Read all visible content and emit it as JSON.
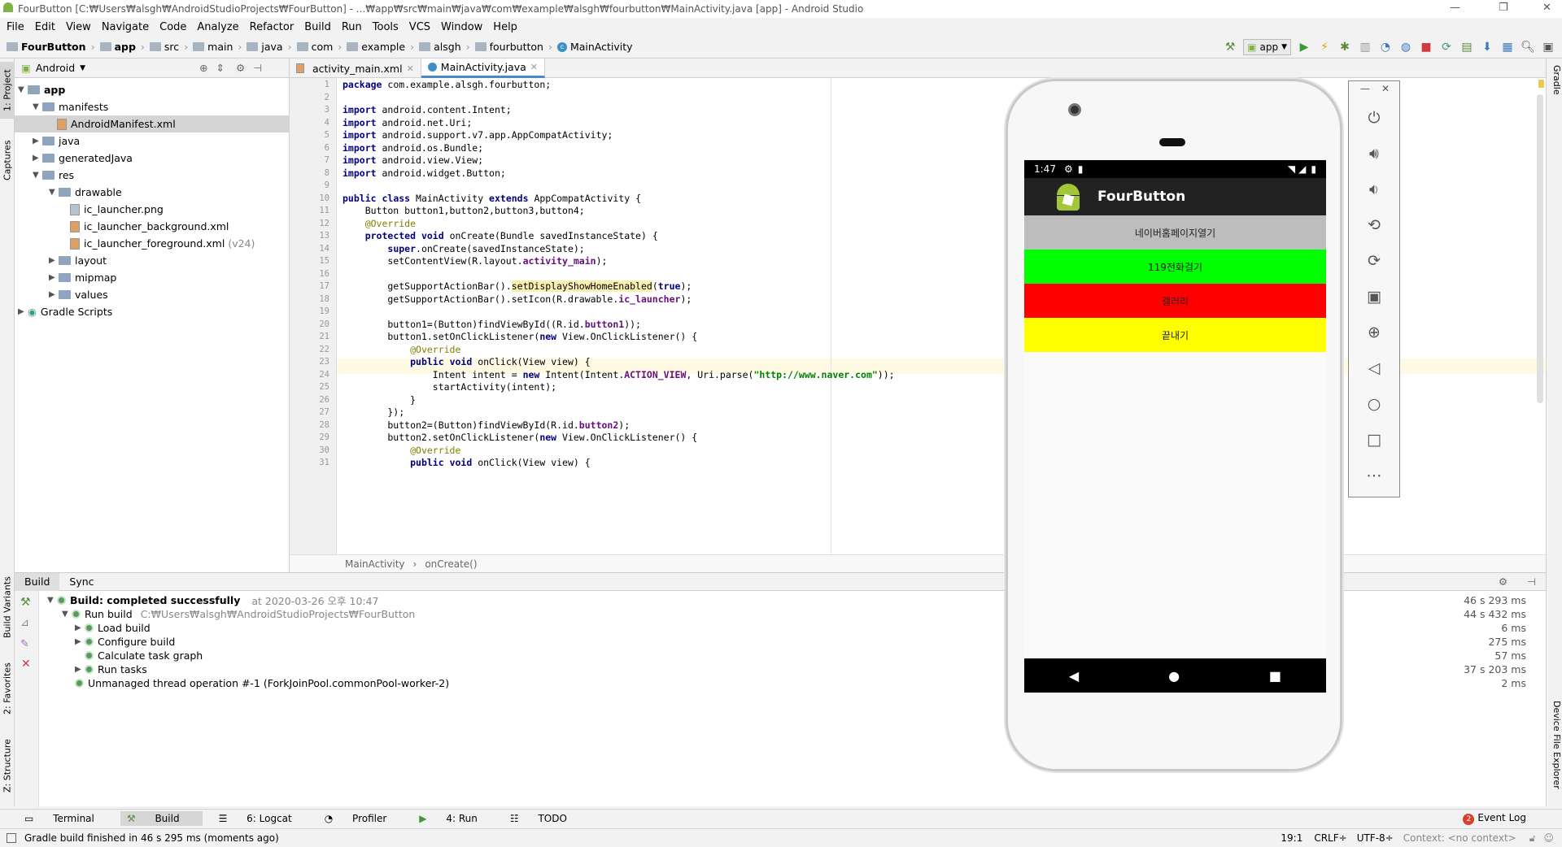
{
  "window": {
    "title": "FourButton [C:₩Users₩alsgh₩AndroidStudioProjects₩FourButton] - ...₩app₩src₩main₩java₩com₩example₩alsgh₩fourbutton₩MainActivity.java [app] - Android Studio"
  },
  "menu": [
    "File",
    "Edit",
    "View",
    "Navigate",
    "Code",
    "Analyze",
    "Refactor",
    "Build",
    "Run",
    "Tools",
    "VCS",
    "Window",
    "Help"
  ],
  "breadcrumb": [
    "FourButton",
    "app",
    "src",
    "main",
    "java",
    "com",
    "example",
    "alsgh",
    "fourbutton",
    "MainActivity"
  ],
  "toolbar": {
    "run_config": "app"
  },
  "left_tools": {
    "project": "1: Project",
    "captures": "Captures",
    "build_variants": "Build Variants",
    "favorites": "2: Favorites",
    "structure": "Z: Structure"
  },
  "right_tools": {
    "gradle": "Gradle",
    "device_explorer": "Device File Explorer"
  },
  "project": {
    "view": "Android",
    "tree": [
      {
        "label": "app",
        "bold": true
      },
      {
        "label": "manifests"
      },
      {
        "label": "AndroidManifest.xml"
      },
      {
        "label": "java"
      },
      {
        "label": "generatedJava"
      },
      {
        "label": "res"
      },
      {
        "label": "drawable"
      },
      {
        "label": "ic_launcher.png"
      },
      {
        "label": "ic_launcher_background.xml"
      },
      {
        "label": "ic_launcher_foreground.xml",
        "suffix": "(v24)"
      },
      {
        "label": "layout"
      },
      {
        "label": "mipmap"
      },
      {
        "label": "values"
      },
      {
        "label": "Gradle Scripts"
      }
    ]
  },
  "editor": {
    "tabs": [
      "activity_main.xml",
      "MainActivity.java"
    ],
    "line_numbers": [
      "1",
      "2",
      "3",
      "4",
      "5",
      "6",
      "7",
      "8",
      "9",
      "10",
      "11",
      "12",
      "13",
      "14",
      "15",
      "16",
      "17",
      "18",
      "19",
      "20",
      "21",
      "22",
      "23",
      "24",
      "25",
      "26",
      "27",
      "28",
      "29",
      "30",
      "31"
    ],
    "code": [
      "package com.example.alsgh.fourbutton;",
      "",
      "import android.content.Intent;",
      "import android.net.Uri;",
      "import android.support.v7.app.AppCompatActivity;",
      "import android.os.Bundle;",
      "import android.view.View;",
      "import android.widget.Button;",
      "",
      "public class MainActivity extends AppCompatActivity {",
      "    Button button1,button2,button3,button4;",
      "    @Override",
      "    protected void onCreate(Bundle savedInstanceState) {",
      "        super.onCreate(savedInstanceState);",
      "        setContentView(R.layout.activity_main);",
      "",
      "        getSupportActionBar().setDisplayShowHomeEnabled(true);",
      "        getSupportActionBar().setIcon(R.drawable.ic_launcher);",
      "",
      "        button1=(Button)findViewById((R.id.button1));",
      "        button1.setOnClickListener(new View.OnClickListener() {",
      "            @Override",
      "            public void onClick(View view) {",
      "                Intent intent = new Intent(Intent.ACTION_VIEW, Uri.parse(\"http://www.naver.com\"));",
      "                startActivity(intent);",
      "            }",
      "        });",
      "        button2=(Button)findViewById(R.id.button2);",
      "        button2.setOnClickListener(new View.OnClickListener() {",
      "            @Override",
      "            public void onClick(View view) {"
    ],
    "crumb": [
      "MainActivity",
      "onCreate()"
    ]
  },
  "build": {
    "tabs": [
      "Build",
      "Sync"
    ],
    "rows": [
      {
        "label": "Build: completed successfully",
        "extra": "at 2020-03-26 오후 10:47",
        "time": "46 s 293 ms"
      },
      {
        "label": "Run build",
        "extra": "C:₩Users₩alsgh₩AndroidStudioProjects₩FourButton",
        "time": "44 s 432 ms"
      },
      {
        "label": "Load build",
        "extra": "",
        "time": "6 ms"
      },
      {
        "label": "Configure build",
        "extra": "",
        "time": "275 ms"
      },
      {
        "label": "Calculate task graph",
        "extra": "",
        "time": "57 ms"
      },
      {
        "label": "Run tasks",
        "extra": "",
        "time": "37 s 203 ms"
      },
      {
        "label": "Unmanaged thread operation #-1 (ForkJoinPool.commonPool-worker-2)",
        "extra": "",
        "time": "2 ms"
      }
    ]
  },
  "bottom_tabs": [
    "Terminal",
    "Build",
    "6: Logcat",
    "Profiler",
    "4: Run",
    "TODO"
  ],
  "event_log": "Event Log",
  "event_count": "2",
  "status": {
    "message": "Gradle build finished in 46 s 295 ms (moments ago)",
    "position": "19:1",
    "line_sep": "CRLF÷",
    "encoding": "UTF-8÷",
    "context": "Context: <no context>"
  },
  "emulator": {
    "time": "1:47",
    "app_title": "FourButton",
    "buttons": [
      {
        "label": "네이버홈페이지열기",
        "color": "#bdbdbd"
      },
      {
        "label": "119전화걸기",
        "color": "#00ff00"
      },
      {
        "label": "갤러리",
        "color": "#ff0000"
      },
      {
        "label": "끝내기",
        "color": "#ffff00"
      }
    ]
  }
}
